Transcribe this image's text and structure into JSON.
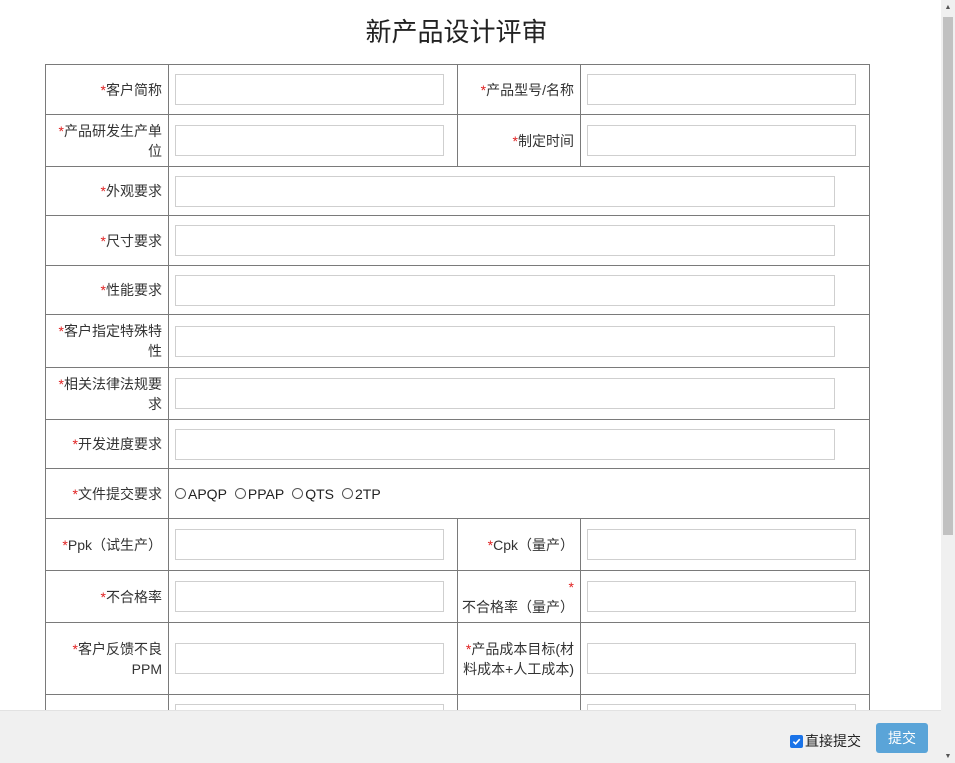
{
  "title": "新产品设计评审",
  "required_mark": "*",
  "fields": {
    "customer_short": "客户简称",
    "product_model": "产品型号/名称",
    "dev_unit": "产品研发生产单位",
    "made_time": "制定时间",
    "appearance": "外观要求",
    "size": "尺寸要求",
    "performance": "性能要求",
    "special": "客户指定特殊特性",
    "law": "相关法律法规要求",
    "schedule": "开发进度要求",
    "docs": "文件提交要求",
    "ppk": "Ppk（试生产）",
    "cpk": "Cpk（量产）",
    "reject_rate": "不合格率",
    "reject_rate_mass": "不合格率（量产）",
    "feedback_ppm": "客户反馈不良PPM",
    "cost_target": "产品成本目标(材料成本+人工成本)"
  },
  "doc_options": [
    "APQP",
    "PPAP",
    "QTS",
    "2TP"
  ],
  "footer": {
    "direct_submit_label": "直接提交",
    "direct_submit_checked": true,
    "submit_label": "提交"
  },
  "colors": {
    "required": "#e02020",
    "submit_button": "#5aa4d8",
    "checkbox": "#1a73e8"
  }
}
